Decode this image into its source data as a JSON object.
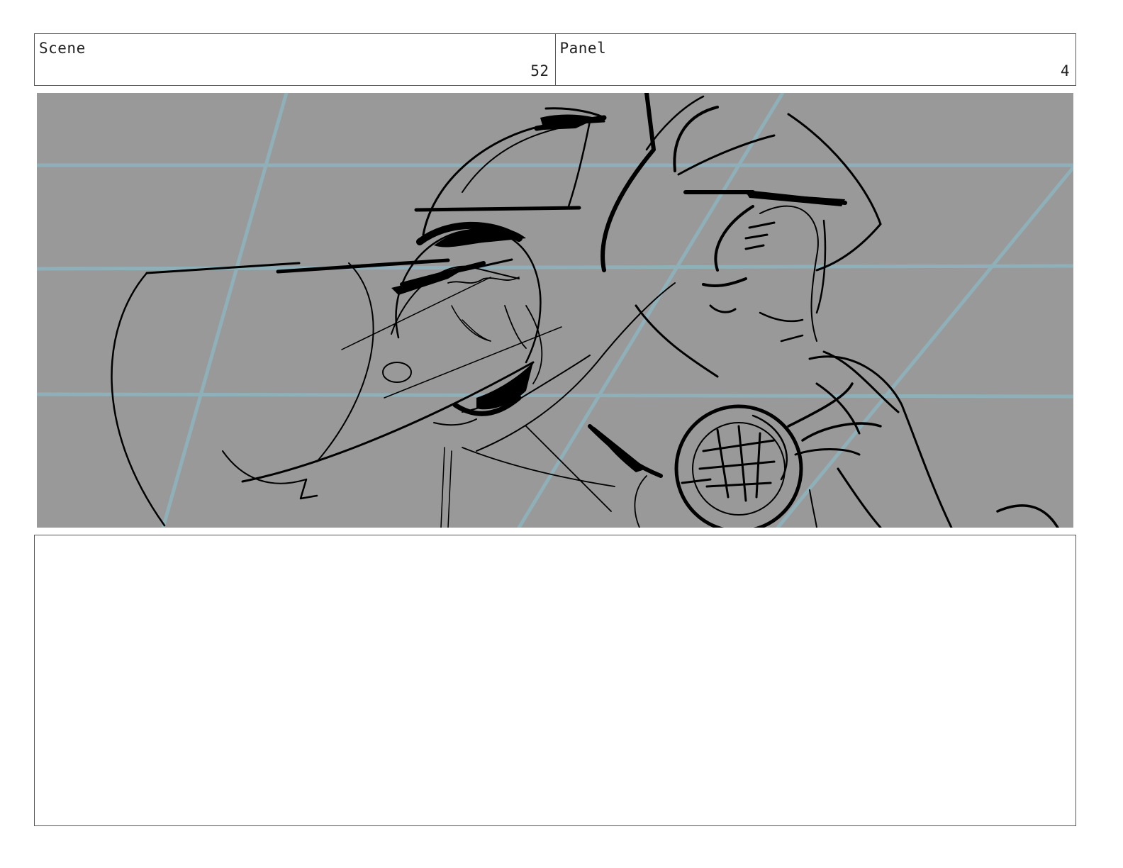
{
  "header": {
    "scene_label": "Scene",
    "scene_number": "52",
    "panel_label": "Panel",
    "panel_number": "4"
  },
  "frame": {
    "background_color": "#999999",
    "guide_line_color": "#8fb0b8",
    "sketch_color": "#000000"
  },
  "notes": {
    "text": ""
  }
}
